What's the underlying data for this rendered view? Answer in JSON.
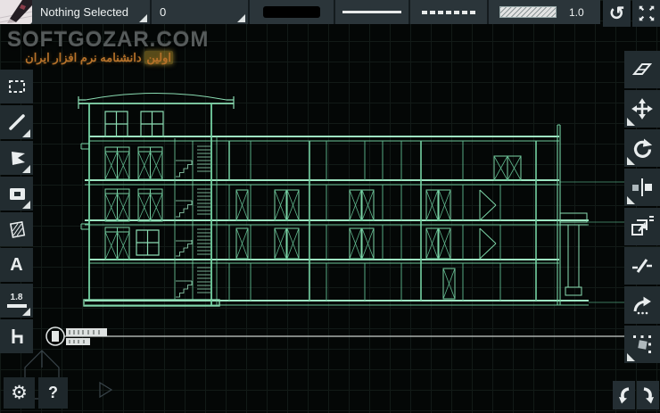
{
  "topbar": {
    "selection_status": "Nothing Selected",
    "layer": "0",
    "linetype_scale": "1.0",
    "current_color": "#000000",
    "icons": [
      "pen-app-icon",
      "undo-icon",
      "zoom-extents-icon"
    ]
  },
  "watermark": {
    "site": "SOFTGOZAR.COM",
    "tagline_first_word": "اولین",
    "tagline_rest": "دانشنامه نرم افزار ایران"
  },
  "left_toolbar": {
    "tools": [
      "select",
      "line",
      "polyline",
      "rectangle",
      "hatch",
      "text",
      "dimension",
      "block"
    ],
    "text_tool_label": "A",
    "dimension_value": "1.8",
    "help_label": "?",
    "icons": [
      "dashed-select-icon",
      "line-icon",
      "polyline-icon",
      "rectangle-icon",
      "hatch-icon",
      "text-a-icon",
      "dimension-icon",
      "block-chair-icon",
      "gear-icon",
      "help-icon"
    ]
  },
  "right_toolbar": {
    "tools": [
      "erase",
      "move",
      "rotate",
      "mirror",
      "copy-offset",
      "trim",
      "fillet",
      "array"
    ],
    "icons": [
      "eraser-icon",
      "move-icon",
      "rotate-icon",
      "mirror-icon",
      "copy-icon",
      "trim-icon",
      "fillet-icon",
      "array-icon",
      "undo-icon",
      "redo-icon"
    ]
  },
  "colors": {
    "toolbar_bg": "#2b353a",
    "canvas_bg": "#040706",
    "grid_line": "#121a17",
    "drawing_green": "#74d1a2",
    "drawing_green_bright": "#9fe6c2",
    "watermark_gray": "#565b5b",
    "tagline_orange": "#b5712a",
    "icon_white": "#e9edee",
    "datum_white": "#c9cecd"
  }
}
